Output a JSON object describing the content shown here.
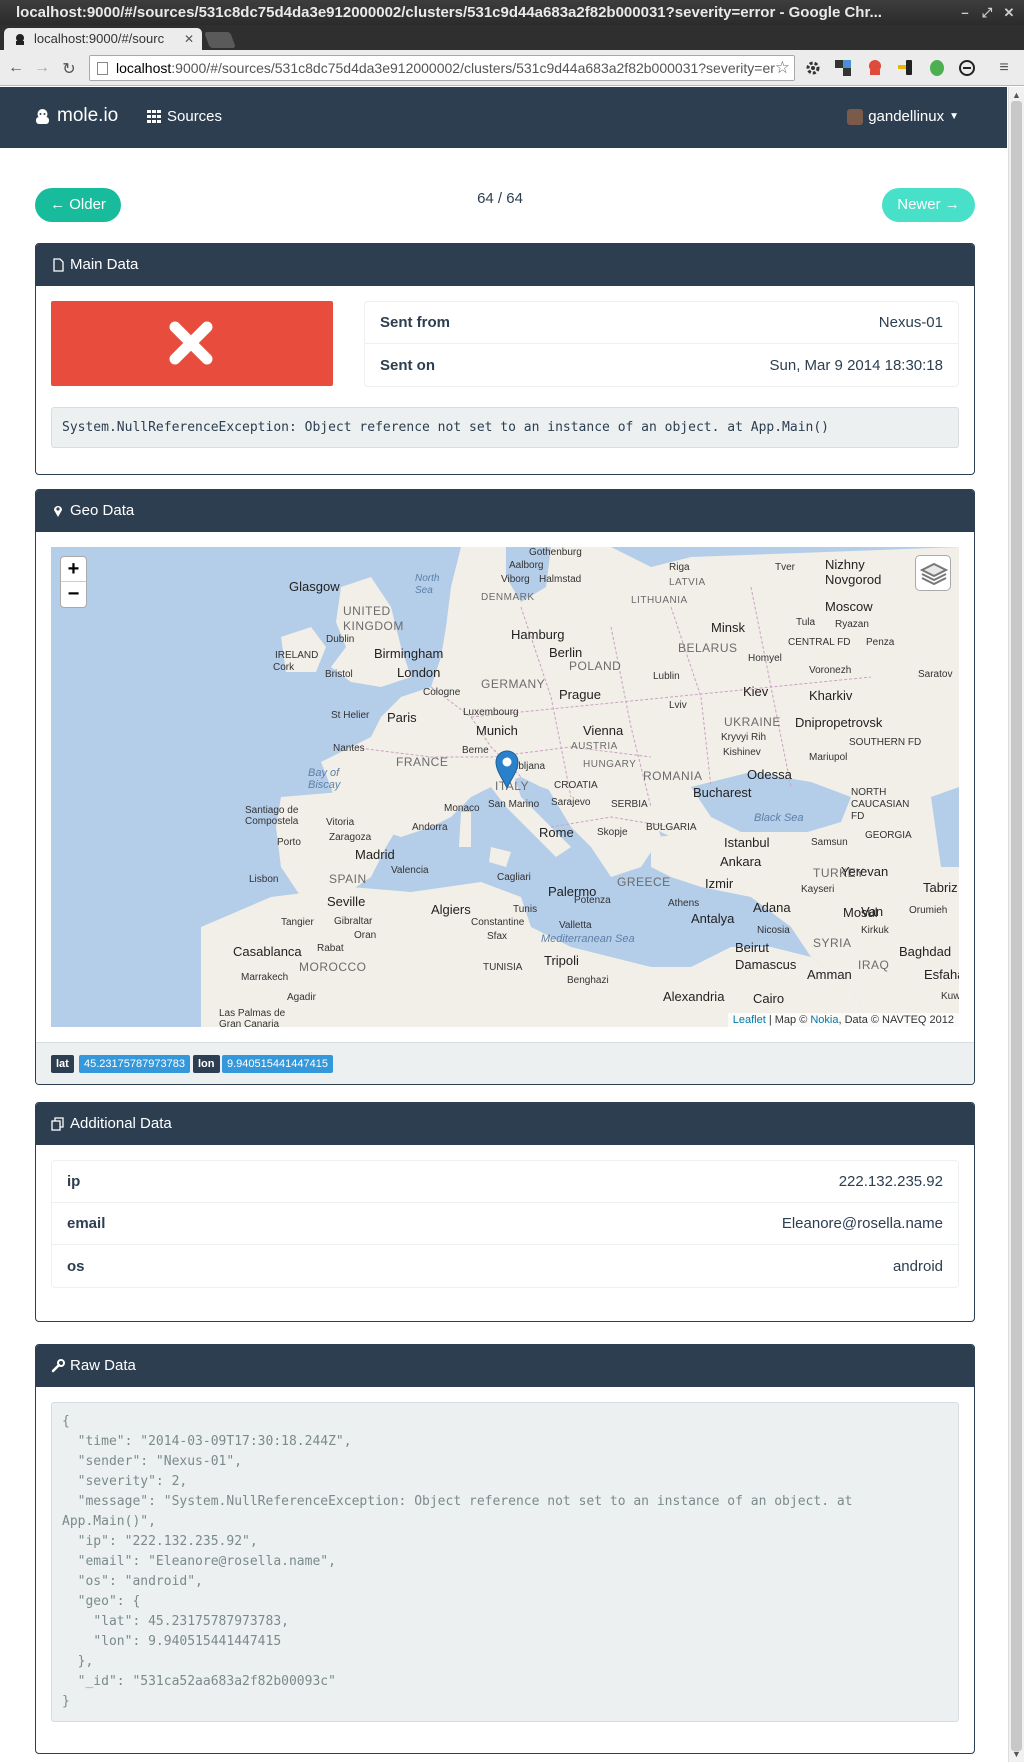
{
  "browser": {
    "window_title": "localhost:9000/#/sources/531c8dc75d4da3e912000002/clusters/531c9d44a683a2f82b000031?severity=error - Google Chr...",
    "tab_title": "localhost:9000/#/sourc",
    "url_host": "localhost",
    "url_rest": ":9000/#/sources/531c8dc75d4da3e912000002/clusters/531c9d44a683a2f82b000031?severity=er"
  },
  "navbar": {
    "brand": "mole.io",
    "sources": "Sources",
    "user": "gandellinux"
  },
  "pager": {
    "older": "← Older",
    "newer": "Newer →",
    "counter": "64 / 64"
  },
  "main_panel": {
    "title": "Main Data",
    "rows": [
      {
        "key": "Sent from",
        "value": "Nexus-01"
      },
      {
        "key": "Sent on",
        "value": "Sun, Mar 9 2014 18:30:18"
      }
    ],
    "message": "System.NullReferenceException: Object reference not set to an instance of an object. at App.Main()",
    "status_color": "#e74c3c"
  },
  "geo_panel": {
    "title": "Geo Data",
    "zoom_in": "+",
    "zoom_out": "−",
    "attribution_link": "Leaflet",
    "attribution_mid": " | Map © ",
    "attribution_nokia": "Nokia",
    "attribution_end": ", Data © NAVTEQ 2012",
    "lat_label": "lat",
    "lat_value": "45.23175787973783",
    "lon_label": "lon",
    "lon_value": "9.940515441447415",
    "cities": [
      "Gothenburg",
      "Aalborg",
      "Viborg",
      "Halmstad",
      "Riga",
      "Tver",
      "Nizhny Novgorod",
      "Glasgow",
      "North Sea",
      "DENMARK",
      "LITHUANIA",
      "LATVIA",
      "Moscow",
      "UNITED KINGDOM",
      "Hamburg",
      "Minsk",
      "Tula",
      "Ryazan",
      "Dublin",
      "Birmingham",
      "Berlin",
      "BELARUS",
      "CENTRAL FD",
      "Penza",
      "IRELAND",
      "Cork",
      "Bristol",
      "London",
      "POLAND",
      "Homyel",
      "Voronezh",
      "Saratov",
      "GERMANY",
      "Lublin",
      "Cologne",
      "Prague",
      "Kiev",
      "Kharkiv",
      "St Helier",
      "Paris",
      "Luxembourg",
      "Lviv",
      "UKRAINE",
      "Dnipropetrovsk",
      "Munich",
      "Vienna",
      "Kryvyi Rih",
      "SOUTHERN FD",
      "Nantes",
      "Berne",
      "AUSTRIA",
      "Kishinev",
      "Mariupol",
      "FRANCE",
      "Ljubljana",
      "HUNGARY",
      "ROMANIA",
      "Odessa",
      "Bay of Biscay",
      "ITALY",
      "CROATIA",
      "Bucharest",
      "San Marino",
      "Sarajevo",
      "SERBIA",
      "Monaco",
      "NORTH CAUCASIAN FD",
      "Santiago de Compostela",
      "Vitoria",
      "Andorra",
      "Black Sea",
      "Porto",
      "Zaragoza",
      "Rome",
      "Skopje",
      "BULGARIA",
      "GEORGIA",
      "Madrid",
      "Istanbul",
      "Samsun",
      "Lisbon",
      "SPAIN",
      "Valencia",
      "Cagliari",
      "Ankara",
      "TURKEY",
      "Yerevan",
      "Tabriz",
      "GREECE",
      "Izmir",
      "Kayseri",
      "Palermo",
      "Seville",
      "Potenza",
      "Athens",
      "Van",
      "Orumieh",
      "Algiers",
      "Tunis",
      "Adana",
      "Mosul",
      "Tangier",
      "Gibraltar",
      "Oran",
      "Constantine",
      "Antalya",
      "Nicosia",
      "Kirkuk",
      "Rabat",
      "Sfax",
      "Mediterranean Sea",
      "Valletta",
      "SYRIA",
      "Casablanca",
      "MOROCCO",
      "TUNISIA",
      "Tripoli",
      "Beirut",
      "Damascus",
      "IRAQ",
      "Baghdad",
      "Marrakech",
      "Benghazi",
      "Amman",
      "Esfahan",
      "Agadir",
      "Alexandria",
      "Cairo",
      "Las Palmas de Gran Canaria",
      "Kuw"
    ]
  },
  "additional_panel": {
    "title": "Additional Data",
    "rows": [
      {
        "key": "ip",
        "value": "222.132.235.92"
      },
      {
        "key": "email",
        "value": "Eleanore@rosella.name"
      },
      {
        "key": "os",
        "value": "android"
      }
    ]
  },
  "raw_panel": {
    "title": "Raw Data",
    "json_text": "{\n  \"time\": \"2014-03-09T17:30:18.244Z\",\n  \"sender\": \"Nexus-01\",\n  \"severity\": 2,\n  \"message\": \"System.NullReferenceException: Object reference not set to an instance of an object. at App.Main()\",\n  \"ip\": \"222.132.235.92\",\n  \"email\": \"Eleanore@rosella.name\",\n  \"os\": \"android\",\n  \"geo\": {\n    \"lat\": 45.23175787973783,\n    \"lon\": 9.940515441447415\n  },\n  \"_id\": \"531ca52aa683a2f82b00093c\"\n}"
  },
  "colors": {
    "primary": "#2c3e50",
    "success": "#18bc9c",
    "danger": "#e74c3c",
    "info": "#3498db",
    "light": "#ecf0f1"
  }
}
